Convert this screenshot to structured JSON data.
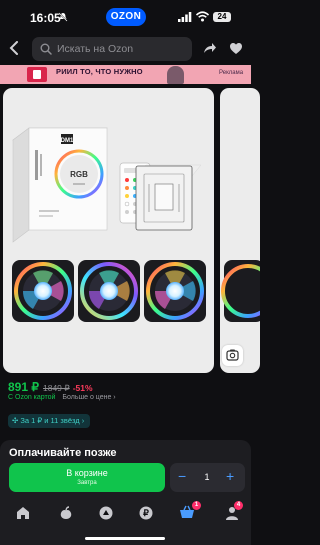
{
  "status_bar": {
    "time": "16:05",
    "brand": "OZON",
    "battery": "24"
  },
  "search": {
    "placeholder": "Искать на Ozon"
  },
  "banner": {
    "headline": "РИИЛ ТО, ЧТО НУЖНО",
    "subline": "",
    "ad_label": "Реклама"
  },
  "product_image": {
    "box_brand": "DM1",
    "box_label": "RGB"
  },
  "price": {
    "current": "891 ₽",
    "old": "1849 ₽",
    "discount": "-51%",
    "card_label": "С Ozon картой",
    "more_label": "Больше о цене ›",
    "rating_chip": "За 1 ₽ и 11 звёзд ›"
  },
  "bottom": {
    "pay_later": "Оплачивайте позже",
    "cart_label": "В корзине",
    "delivery": "Завтра",
    "quantity": "1",
    "minus": "−",
    "plus": "+"
  },
  "tabbar": {
    "cart_badge": "1",
    "profile_badge": "4"
  },
  "colors": {
    "accent_green": "#10c44c",
    "brand_blue": "#005bff",
    "discount_red": "#ff3b5c"
  }
}
